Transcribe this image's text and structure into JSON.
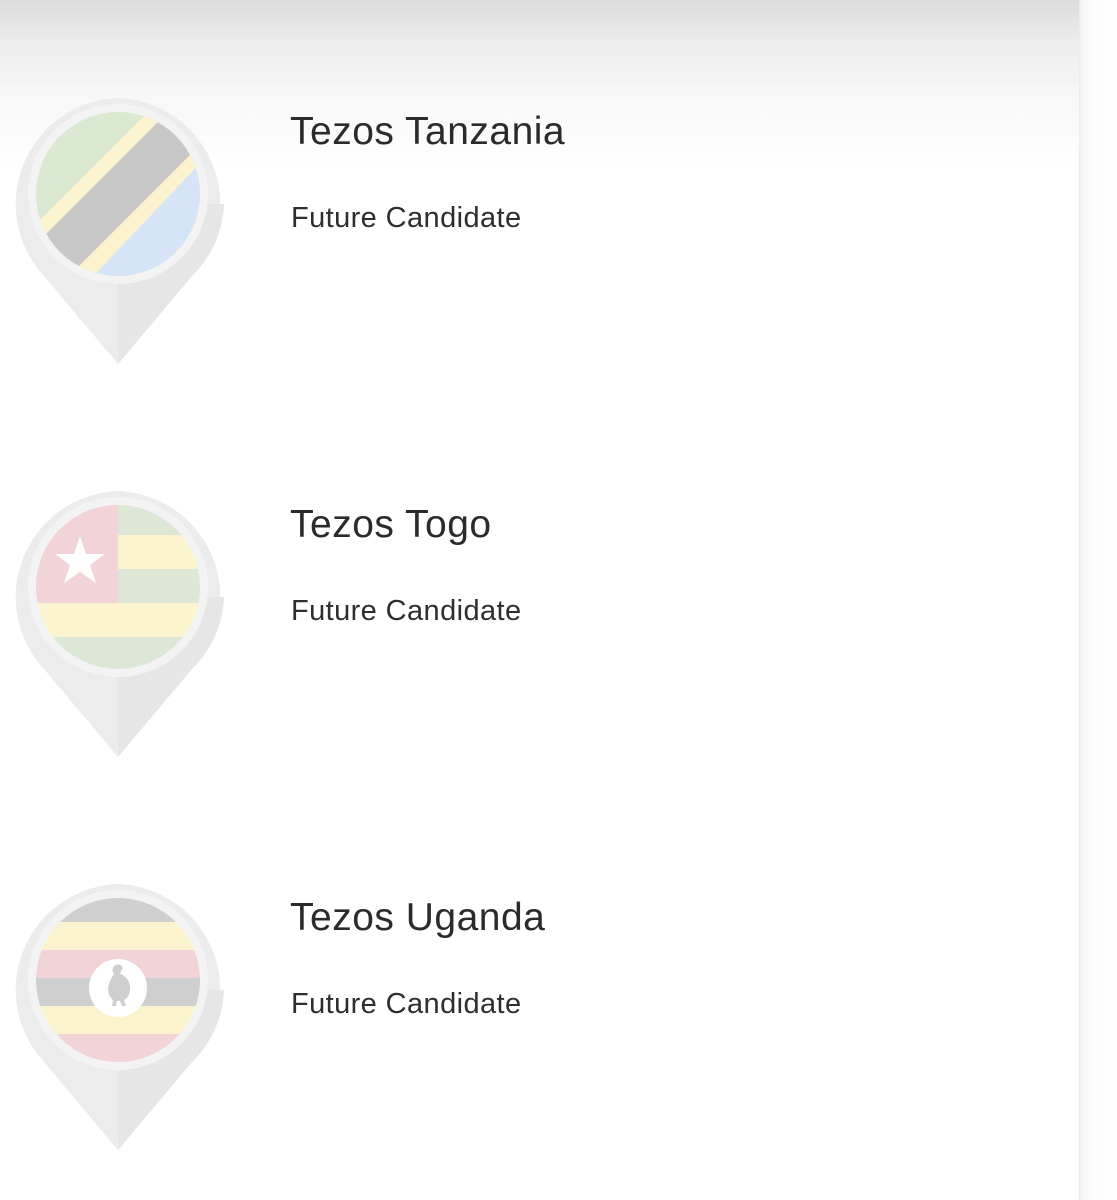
{
  "candidates": [
    {
      "name": "Tezos Tanzania",
      "status": "Future Candidate",
      "flag_icon": "tanzania-flag-icon"
    },
    {
      "name": "Tezos Togo",
      "status": "Future Candidate",
      "flag_icon": "togo-flag-icon"
    },
    {
      "name": "Tezos Uganda",
      "status": "Future Candidate",
      "flag_icon": "uganda-flag-icon"
    }
  ],
  "colors": {
    "pin": "#ececec",
    "pin_inner": "#f4f4f4",
    "text": "#2b2b2b"
  }
}
